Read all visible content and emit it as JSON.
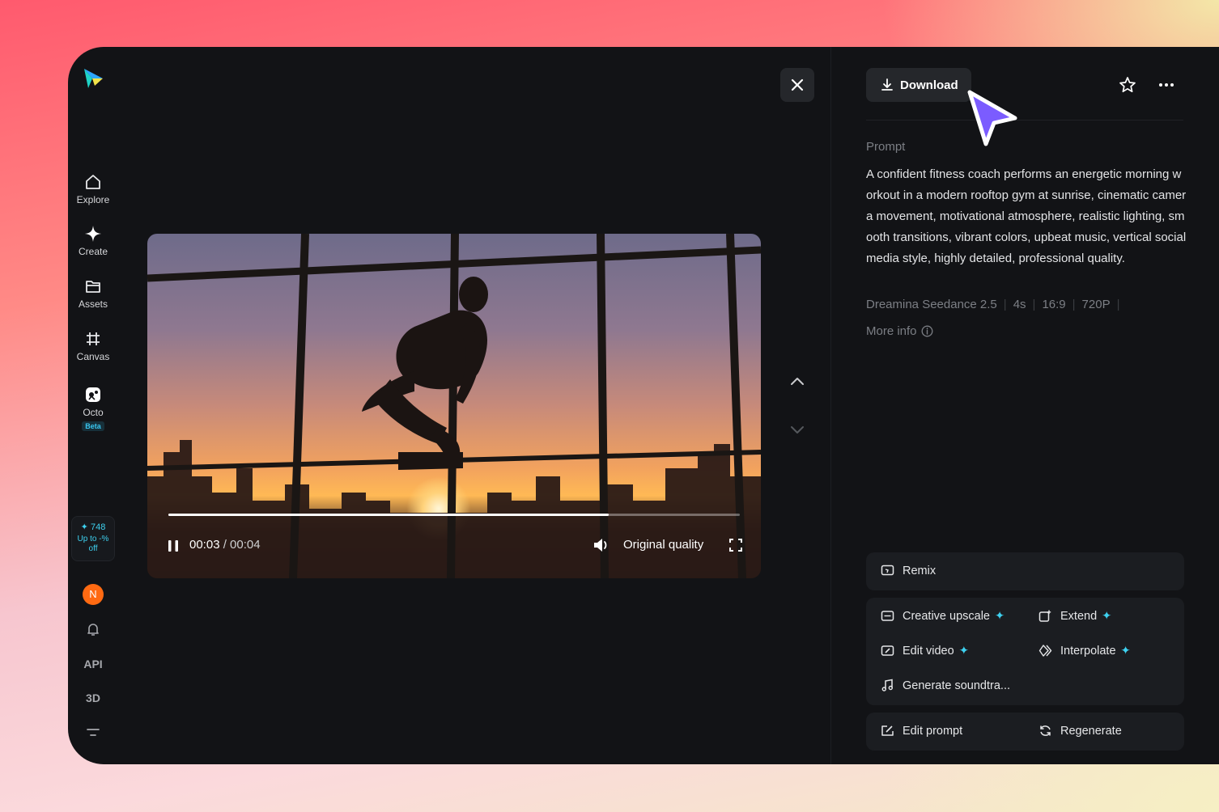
{
  "sidebar": {
    "items": [
      {
        "label": "Explore",
        "icon": "home-icon"
      },
      {
        "label": "Create",
        "icon": "sparkle-icon"
      },
      {
        "label": "Assets",
        "icon": "folder-icon"
      },
      {
        "label": "Canvas",
        "icon": "canvas-icon"
      },
      {
        "label": "Octo",
        "icon": "octo-icon",
        "badge": "Beta"
      }
    ],
    "credits": {
      "count": "748",
      "promo_line1": "Up to -%",
      "promo_line2": "off"
    },
    "avatar_initial": "N",
    "api_label": "API",
    "three_d_label": "3D"
  },
  "player": {
    "current_time": "00:03",
    "duration": "/ 00:04",
    "progress_fraction": 0.77,
    "quality": "Original quality"
  },
  "panel": {
    "download_label": "Download",
    "prompt_heading": "Prompt",
    "prompt_text": "A confident fitness coach performs an energetic morning workout in a modern rooftop gym at sunrise, cinematic camera movement, motivational atmosphere, realistic lighting, smooth transitions, vibrant colors, upbeat music, vertical social media style, highly detailed, professional quality.",
    "meta": {
      "model": "Dreamina Seedance 2.5",
      "duration": "4s",
      "ratio": "16:9",
      "resolution": "720P"
    },
    "more_info": "More info",
    "actions": {
      "remix": "Remix",
      "creative_upscale": "Creative upscale",
      "extend": "Extend",
      "edit_video": "Edit video",
      "interpolate": "Interpolate",
      "generate_soundtrack": "Generate soundtra...",
      "edit_prompt": "Edit prompt",
      "regenerate": "Regenerate"
    }
  },
  "colors": {
    "accent": "#3ed1f0",
    "cursor": "#7b5cff",
    "avatar": "#ff6a12"
  }
}
